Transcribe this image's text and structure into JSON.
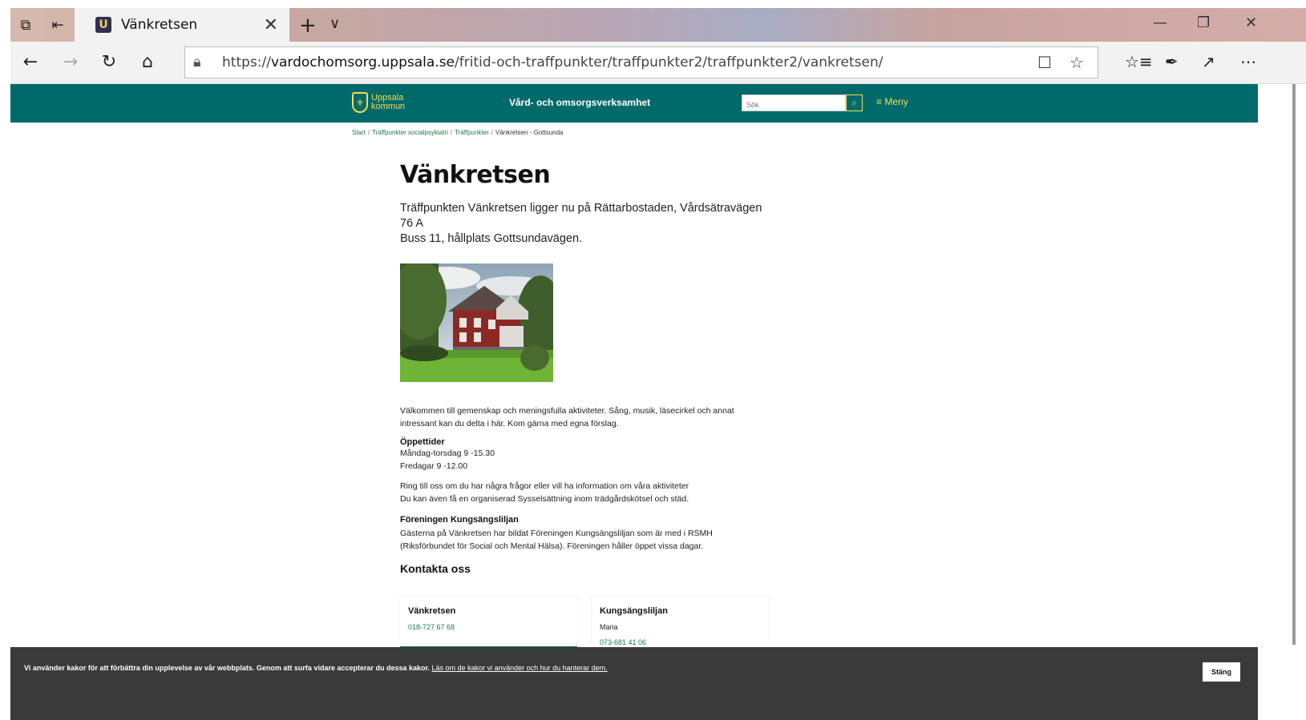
{
  "browser": {
    "tab_title": "Vänkretsen",
    "tab_favicon_letter": "U",
    "url_scheme": "https://",
    "url_host": "vardochomsorg.uppsala.se",
    "url_path": "/fritid-och-traffpunkter/traffpunkter2/traffpunkter2/vankretsen/"
  },
  "site": {
    "logo_line1": "Uppsala",
    "logo_line2": "kommun",
    "subtitle": "Vård- och omsorgsverksamhet",
    "search_placeholder": "Sök",
    "menu_label": "Meny"
  },
  "breadcrumb": {
    "items": [
      "Start",
      "Träffpunkter socialpsykiatri",
      "Träffpunkter"
    ],
    "current": "Vänkretsen - Gottsunda",
    "separator": "/"
  },
  "article": {
    "title": "Vänkretsen",
    "lead_line1": "Träffpunkten Vänkretsen ligger nu på Rättarbostaden, Vårdsätravägen 76 A",
    "lead_line2": "Buss 11, hållplats Gottsundavägen.",
    "intro_line1": "Välkommen till gemenskap och meningsfulla aktiviteter. Sång, musik, läsecirkel och annat",
    "intro_line2": "intressant kan du delta i här. Kom gärna med egna förslag.",
    "hours_heading": "Öppettider",
    "hours_line1": "Måndag-torsdag 9 -15.30",
    "hours_line2": "Fredagar 9 -12.00",
    "info_line1": "Ring till oss om du har några frågor eller vill ha information om våra aktiviteter",
    "info_line2": "Du kan även få en organiserad Sysselsättning inom trädgårdskötsel och städ.",
    "assoc_heading": "Föreningen Kungsängsliljan",
    "assoc_line1": "Gästerna på Vänkretsen har bildat Föreningen Kungsängsliljan som är med i RSMH",
    "assoc_line2": "(Riksförbundet för Social och Mental Hälsa). Föreningen håller öppet vissa dagar.",
    "contact_heading": "Kontakta oss"
  },
  "contacts": [
    {
      "title": "Vänkretsen",
      "name": "",
      "phone": "018-727 67 68"
    },
    {
      "title": "Kungsängsliljan",
      "name": "Maria",
      "phone": "073-681 41 06"
    }
  ],
  "cookie": {
    "text": "Vi använder kakor för att förbättra din upplevelse av vår webbplats. Genom att surfa vidare accepterar du dessa kakor.",
    "link": "Läs om de kakor vi använder och hur du hanterar dem.",
    "close_label": "Stäng"
  },
  "colors": {
    "header_bg": "#006a6a",
    "accent_yellow": "#f4dc52",
    "link_green": "#1d7a46",
    "cookie_bg": "#3a3a3a"
  }
}
